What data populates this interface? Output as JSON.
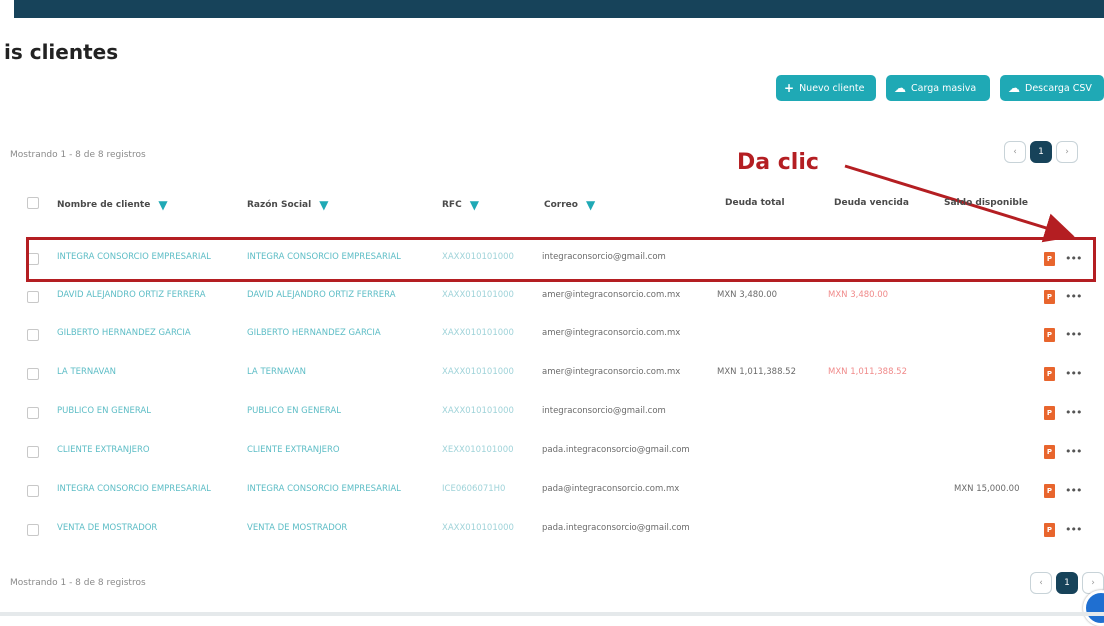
{
  "page": {
    "title": "is clientes"
  },
  "actions": {
    "new_client": "Nuevo cliente",
    "bulk_upload": "Carga masiva",
    "download_csv": "Descarga CSV"
  },
  "showing_text": "Mostrando 1 - 8 de 8 registros",
  "pagination": {
    "current_page": "1"
  },
  "annotation": {
    "label": "Da clic"
  },
  "columns": {
    "name": "Nombre de cliente",
    "razon": "Razón Social",
    "rfc": "RFC",
    "email": "Correo",
    "deuda_total": "Deuda total",
    "deuda_vencida": "Deuda vencida",
    "saldo": "Saldo disponible"
  },
  "rows": [
    {
      "name": "INTEGRA CONSORCIO EMPRESARIAL",
      "razon": "INTEGRA CONSORCIO EMPRESARIAL",
      "rfc": "XAXX010101000",
      "email": "integraconsorcio@gmail.com",
      "deuda_total": "",
      "deuda_vencida": "",
      "saldo": ""
    },
    {
      "name": "DAVID ALEJANDRO ORTIZ FERRERA",
      "razon": "DAVID ALEJANDRO ORTIZ FERRERA",
      "rfc": "XAXX010101000",
      "email": "amer@integraconsorcio.com.mx",
      "deuda_total": "MXN 3,480.00",
      "deuda_vencida": "MXN 3,480.00",
      "saldo": ""
    },
    {
      "name": "GILBERTO HERNANDEZ GARCIA",
      "razon": "GILBERTO HERNANDEZ GARCIA",
      "rfc": "XAXX010101000",
      "email": "amer@integraconsorcio.com.mx",
      "deuda_total": "",
      "deuda_vencida": "",
      "saldo": ""
    },
    {
      "name": "LA TERNAVAN",
      "razon": "LA TERNAVAN",
      "rfc": "XAXX010101000",
      "email": "amer@integraconsorcio.com.mx",
      "deuda_total": "MXN 1,011,388.52",
      "deuda_vencida": "MXN 1,011,388.52",
      "saldo": ""
    },
    {
      "name": "PUBLICO EN GENERAL",
      "razon": "PUBLICO EN GENERAL",
      "rfc": "XAXX010101000",
      "email": "integraconsorcio@gmail.com",
      "deuda_total": "",
      "deuda_vencida": "",
      "saldo": ""
    },
    {
      "name": "CLIENTE EXTRANJERO",
      "razon": "CLIENTE EXTRANJERO",
      "rfc": "XEXX010101000",
      "email": "pada.integraconsorcio@gmail.com",
      "deuda_total": "",
      "deuda_vencida": "",
      "saldo": ""
    },
    {
      "name": "INTEGRA CONSORCIO EMPRESARIAL",
      "razon": "INTEGRA CONSORCIO EMPRESARIAL",
      "rfc": "ICE0606071H0",
      "email": "pada@integraconsorcio.com.mx",
      "deuda_total": "",
      "deuda_vencida": "",
      "saldo": "MXN 15,000.00"
    },
    {
      "name": "VENTA DE MOSTRADOR",
      "razon": "VENTA DE MOSTRADOR",
      "rfc": "XAXX010101000",
      "email": "pada.integraconsorcio@gmail.com",
      "deuda_total": "",
      "deuda_vencida": "",
      "saldo": ""
    }
  ],
  "colors": {
    "accent": "#1fa9b5",
    "nav": "#17435a",
    "annotation": "#b41e22",
    "pdf": "#e8652d"
  },
  "icons": {
    "filter": "filter-icon",
    "pdf": "pdf-icon",
    "more": "more-options-icon"
  }
}
